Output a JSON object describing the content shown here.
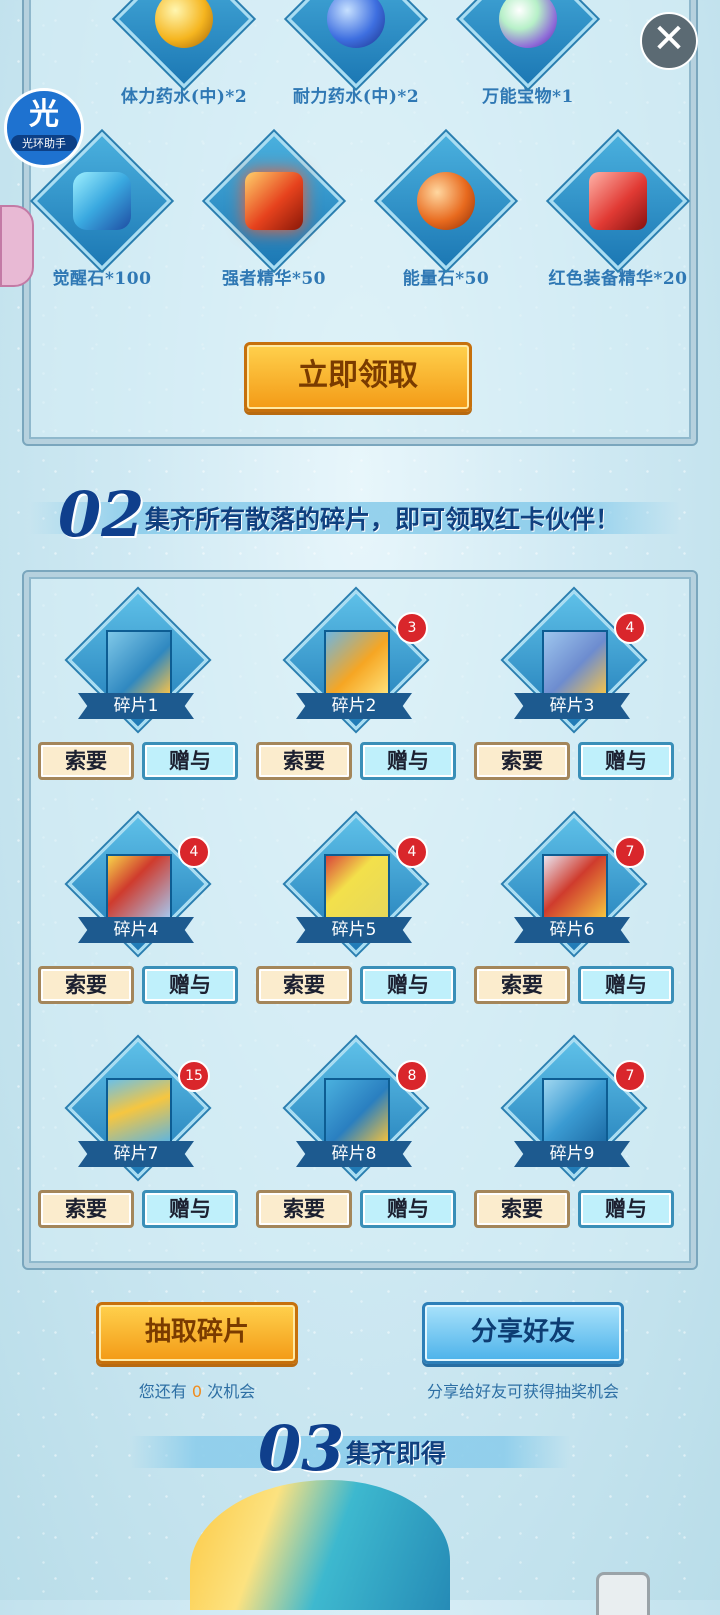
{
  "rewards_row1": [
    {
      "label": "体力药水(中)*2",
      "icon": "potion-yellow-icon",
      "color": "#f5b51f"
    },
    {
      "label": "耐力药水(中)*2",
      "icon": "potion-blue-icon",
      "color": "#3e6fe0"
    },
    {
      "label": "万能宝物*1",
      "icon": "orb-rainbow-icon",
      "color": "#8e6ad8"
    }
  ],
  "rewards_row2": [
    {
      "label": "觉醒石*100",
      "icon": "crystal-blue-icon",
      "color": "#3aa9e0"
    },
    {
      "label": "强者精华*50",
      "icon": "crystal-fire-icon",
      "color": "#e6421d"
    },
    {
      "label": "能量石*50",
      "icon": "energy-orb-icon",
      "color": "#e86a1e"
    },
    {
      "label": "红色装备精华*20",
      "icon": "red-gem-icon",
      "color": "#e13a34"
    }
  ],
  "claim_button": "立即领取",
  "section2": {
    "num": "02",
    "title": "集齐所有散落的碎片，即可领取红卡伙伴！"
  },
  "fragments": [
    {
      "label": "碎片1",
      "count": ""
    },
    {
      "label": "碎片2",
      "count": "3"
    },
    {
      "label": "碎片3",
      "count": "4"
    },
    {
      "label": "碎片4",
      "count": "4"
    },
    {
      "label": "碎片5",
      "count": "4"
    },
    {
      "label": "碎片6",
      "count": "7"
    },
    {
      "label": "碎片7",
      "count": "15"
    },
    {
      "label": "碎片8",
      "count": "8"
    },
    {
      "label": "碎片9",
      "count": "7"
    }
  ],
  "ask_label": "索要",
  "give_label": "赠与",
  "draw_button": "抽取碎片",
  "share_button": "分享好友",
  "chances": {
    "prefix": "您还有",
    "count": "0",
    "suffix": "次机会"
  },
  "share_hint": "分享给好友可获得抽奖机会",
  "section3": {
    "num": "03",
    "title": "集齐即得"
  },
  "helper": {
    "big": "光",
    "small": "光环助手"
  },
  "close_symbol": "✕"
}
